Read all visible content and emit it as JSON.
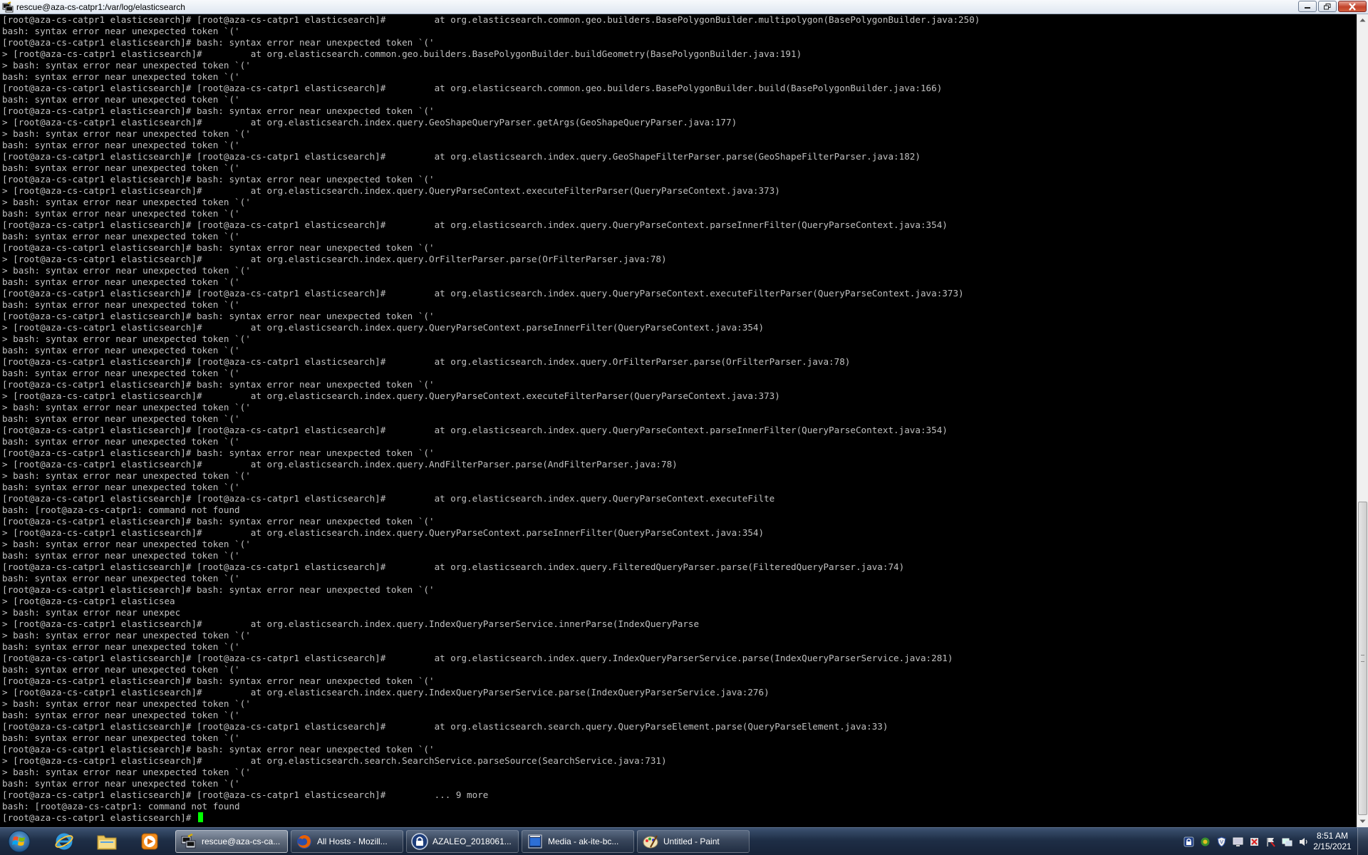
{
  "window": {
    "title": "rescue@aza-cs-catpr1:/var/log/elasticsearch",
    "icon": "putty-icon",
    "controls": [
      "minimize-icon",
      "maximize-icon",
      "close-icon"
    ]
  },
  "terminal": {
    "background": "#000000",
    "foreground": "#c0c0c0",
    "cursor_color": "#00ff00",
    "lines": [
      "[root@aza-cs-catpr1 elasticsearch]# [root@aza-cs-catpr1 elasticsearch]#         at org.elasticsearch.common.geo.builders.BasePolygonBuilder.multipolygon(BasePolygonBuilder.java:250)",
      "bash: syntax error near unexpected token `('",
      "[root@aza-cs-catpr1 elasticsearch]# bash: syntax error near unexpected token `('",
      "> [root@aza-cs-catpr1 elasticsearch]#         at org.elasticsearch.common.geo.builders.BasePolygonBuilder.buildGeometry(BasePolygonBuilder.java:191)",
      "> bash: syntax error near unexpected token `('",
      "bash: syntax error near unexpected token `('",
      "[root@aza-cs-catpr1 elasticsearch]# [root@aza-cs-catpr1 elasticsearch]#         at org.elasticsearch.common.geo.builders.BasePolygonBuilder.build(BasePolygonBuilder.java:166)",
      "bash: syntax error near unexpected token `('",
      "[root@aza-cs-catpr1 elasticsearch]# bash: syntax error near unexpected token `('",
      "> [root@aza-cs-catpr1 elasticsearch]#         at org.elasticsearch.index.query.GeoShapeQueryParser.getArgs(GeoShapeQueryParser.java:177)",
      "> bash: syntax error near unexpected token `('",
      "bash: syntax error near unexpected token `('",
      "[root@aza-cs-catpr1 elasticsearch]# [root@aza-cs-catpr1 elasticsearch]#         at org.elasticsearch.index.query.GeoShapeFilterParser.parse(GeoShapeFilterParser.java:182)",
      "bash: syntax error near unexpected token `('",
      "[root@aza-cs-catpr1 elasticsearch]# bash: syntax error near unexpected token `('",
      "> [root@aza-cs-catpr1 elasticsearch]#         at org.elasticsearch.index.query.QueryParseContext.executeFilterParser(QueryParseContext.java:373)",
      "> bash: syntax error near unexpected token `('",
      "bash: syntax error near unexpected token `('",
      "[root@aza-cs-catpr1 elasticsearch]# [root@aza-cs-catpr1 elasticsearch]#         at org.elasticsearch.index.query.QueryParseContext.parseInnerFilter(QueryParseContext.java:354)",
      "bash: syntax error near unexpected token `('",
      "[root@aza-cs-catpr1 elasticsearch]# bash: syntax error near unexpected token `('",
      "> [root@aza-cs-catpr1 elasticsearch]#         at org.elasticsearch.index.query.OrFilterParser.parse(OrFilterParser.java:78)",
      "> bash: syntax error near unexpected token `('",
      "bash: syntax error near unexpected token `('",
      "[root@aza-cs-catpr1 elasticsearch]# [root@aza-cs-catpr1 elasticsearch]#         at org.elasticsearch.index.query.QueryParseContext.executeFilterParser(QueryParseContext.java:373)",
      "bash: syntax error near unexpected token `('",
      "[root@aza-cs-catpr1 elasticsearch]# bash: syntax error near unexpected token `('",
      "> [root@aza-cs-catpr1 elasticsearch]#         at org.elasticsearch.index.query.QueryParseContext.parseInnerFilter(QueryParseContext.java:354)",
      "> bash: syntax error near unexpected token `('",
      "bash: syntax error near unexpected token `('",
      "[root@aza-cs-catpr1 elasticsearch]# [root@aza-cs-catpr1 elasticsearch]#         at org.elasticsearch.index.query.OrFilterParser.parse(OrFilterParser.java:78)",
      "bash: syntax error near unexpected token `('",
      "[root@aza-cs-catpr1 elasticsearch]# bash: syntax error near unexpected token `('",
      "> [root@aza-cs-catpr1 elasticsearch]#         at org.elasticsearch.index.query.QueryParseContext.executeFilterParser(QueryParseContext.java:373)",
      "> bash: syntax error near unexpected token `('",
      "bash: syntax error near unexpected token `('",
      "[root@aza-cs-catpr1 elasticsearch]# [root@aza-cs-catpr1 elasticsearch]#         at org.elasticsearch.index.query.QueryParseContext.parseInnerFilter(QueryParseContext.java:354)",
      "bash: syntax error near unexpected token `('",
      "[root@aza-cs-catpr1 elasticsearch]# bash: syntax error near unexpected token `('",
      "> [root@aza-cs-catpr1 elasticsearch]#         at org.elasticsearch.index.query.AndFilterParser.parse(AndFilterParser.java:78)",
      "> bash: syntax error near unexpected token `('",
      "bash: syntax error near unexpected token `('",
      "[root@aza-cs-catpr1 elasticsearch]# [root@aza-cs-catpr1 elasticsearch]#         at org.elasticsearch.index.query.QueryParseContext.executeFilte",
      "bash: [root@aza-cs-catpr1: command not found",
      "[root@aza-cs-catpr1 elasticsearch]# bash: syntax error near unexpected token `('",
      "> [root@aza-cs-catpr1 elasticsearch]#         at org.elasticsearch.index.query.QueryParseContext.parseInnerFilter(QueryParseContext.java:354)",
      "> bash: syntax error near unexpected token `('",
      "bash: syntax error near unexpected token `('",
      "[root@aza-cs-catpr1 elasticsearch]# [root@aza-cs-catpr1 elasticsearch]#         at org.elasticsearch.index.query.FilteredQueryParser.parse(FilteredQueryParser.java:74)",
      "bash: syntax error near unexpected token `('",
      "[root@aza-cs-catpr1 elasticsearch]# bash: syntax error near unexpected token `('",
      "> [root@aza-cs-catpr1 elasticsea",
      "> bash: syntax error near unexpec",
      "> [root@aza-cs-catpr1 elasticsearch]#         at org.elasticsearch.index.query.IndexQueryParserService.innerParse(IndexQueryParse",
      "> bash: syntax error near unexpected token `('",
      "bash: syntax error near unexpected token `('",
      "[root@aza-cs-catpr1 elasticsearch]# [root@aza-cs-catpr1 elasticsearch]#         at org.elasticsearch.index.query.IndexQueryParserService.parse(IndexQueryParserService.java:281)",
      "bash: syntax error near unexpected token `('",
      "[root@aza-cs-catpr1 elasticsearch]# bash: syntax error near unexpected token `('",
      "> [root@aza-cs-catpr1 elasticsearch]#         at org.elasticsearch.index.query.IndexQueryParserService.parse(IndexQueryParserService.java:276)",
      "> bash: syntax error near unexpected token `('",
      "bash: syntax error near unexpected token `('",
      "[root@aza-cs-catpr1 elasticsearch]# [root@aza-cs-catpr1 elasticsearch]#         at org.elasticsearch.search.query.QueryParseElement.parse(QueryParseElement.java:33)",
      "bash: syntax error near unexpected token `('",
      "[root@aza-cs-catpr1 elasticsearch]# bash: syntax error near unexpected token `('",
      "> [root@aza-cs-catpr1 elasticsearch]#         at org.elasticsearch.search.SearchService.parseSource(SearchService.java:731)",
      "> bash: syntax error near unexpected token `('",
      "bash: syntax error near unexpected token `('",
      "[root@aza-cs-catpr1 elasticsearch]# [root@aza-cs-catpr1 elasticsearch]#         ... 9 more",
      "bash: [root@aza-cs-catpr1: command not found"
    ],
    "prompt": "[root@aza-cs-catpr1 elasticsearch]# "
  },
  "taskbar": {
    "start_icon": "windows-start-icon",
    "pinned": [
      {
        "name": "internet-explorer-icon"
      },
      {
        "name": "folder-icon"
      },
      {
        "name": "media-player-icon"
      }
    ],
    "tasks": [
      {
        "label": "rescue@aza-cs-ca...",
        "icon": "putty-icon",
        "active": true
      },
      {
        "label": "All Hosts - Mozill...",
        "icon": "firefox-icon",
        "active": false
      },
      {
        "label": "AZALEO_2018061...",
        "icon": "lock-icon",
        "active": false
      },
      {
        "label": "Media - ak-ite-bc...",
        "icon": "media-window-icon",
        "active": false
      },
      {
        "label": "Untitled - Paint",
        "icon": "paint-icon",
        "active": false
      }
    ],
    "tray_icons": [
      "security-icon",
      "network-shield-icon",
      "antivirus-icon",
      "monitor-icon",
      "update-icon",
      "flag-icon",
      "network-icon",
      "volume-icon"
    ],
    "clock_time": "8:51 AM",
    "clock_date": "2/15/2021"
  }
}
